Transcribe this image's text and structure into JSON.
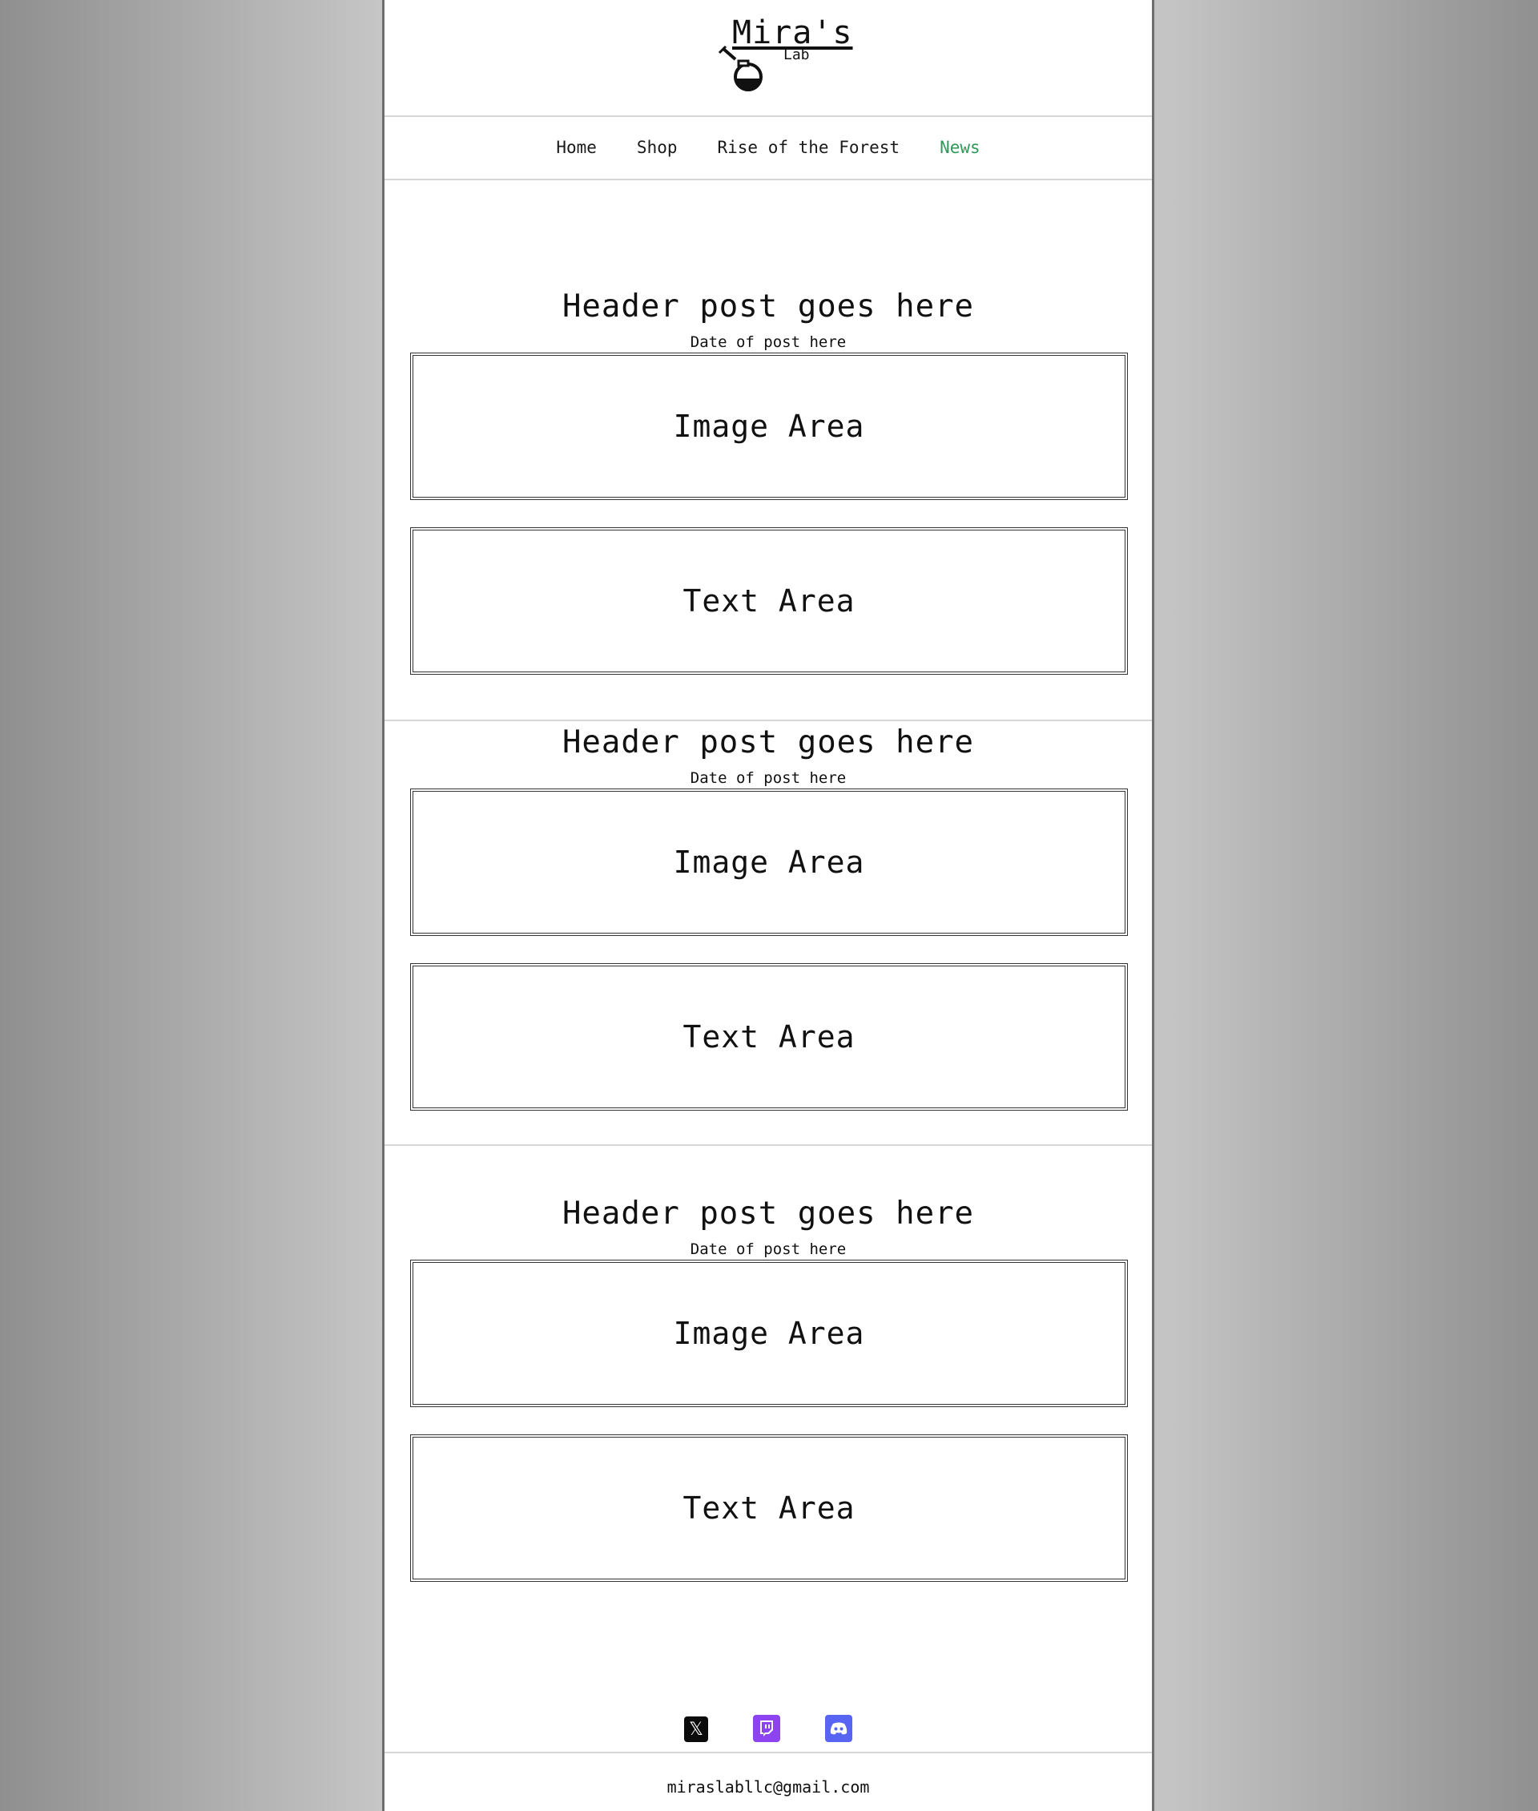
{
  "brand": {
    "title": "Mira's",
    "subtitle": "Lab"
  },
  "nav": {
    "items": [
      {
        "label": "Home"
      },
      {
        "label": "Shop"
      },
      {
        "label": "Rise of the Forest"
      },
      {
        "label": "News"
      }
    ],
    "active": "News"
  },
  "posts": [
    {
      "title": "Header post goes here",
      "date": "Date of post here",
      "image_label": "Image Area",
      "text_label": "Text Area"
    },
    {
      "title": "Header post goes here",
      "date": "Date of post here",
      "image_label": "Image Area",
      "text_label": "Text Area"
    },
    {
      "title": "Header post goes here",
      "date": "Date of post here",
      "image_label": "Image Area",
      "text_label": "Text Area"
    }
  ],
  "socials": [
    {
      "icon": "x-twitter-icon",
      "glyph": "𝕏",
      "color": "#0b0b0b"
    },
    {
      "icon": "twitch-icon",
      "color": "#8d44f0"
    },
    {
      "icon": "discord-icon",
      "color": "#5865f2"
    }
  ],
  "footer": {
    "email": "miraslabllc@gmail.com"
  },
  "colors": {
    "active_nav": "#2e9a5a"
  }
}
